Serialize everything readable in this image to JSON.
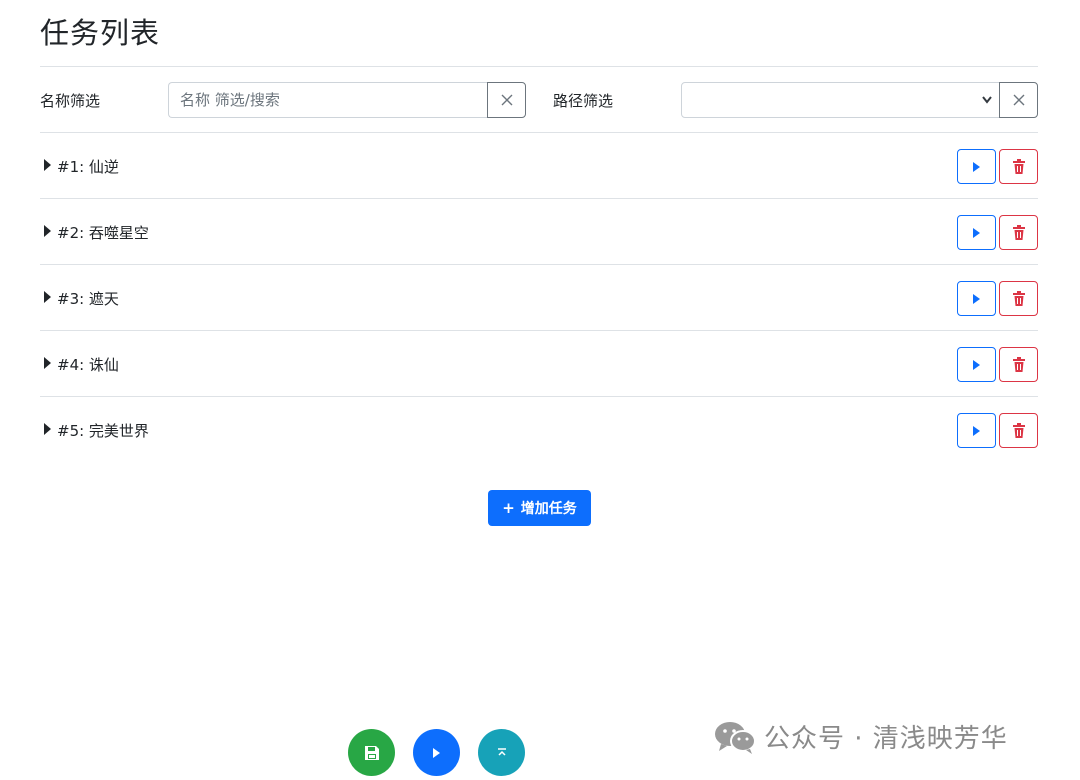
{
  "page": {
    "title": "任务列表"
  },
  "filters": {
    "name_label": "名称筛选",
    "name_placeholder": "名称 筛选/搜索",
    "name_value": "",
    "path_label": "路径筛选",
    "path_selected": ""
  },
  "tasks": [
    {
      "label": "#1: 仙逆"
    },
    {
      "label": "#2: 吞噬星空"
    },
    {
      "label": "#3: 遮天"
    },
    {
      "label": "#4: 诛仙"
    },
    {
      "label": "#5: 完美世界"
    }
  ],
  "actions": {
    "add_plus": "+",
    "add_label": "增加任务"
  },
  "watermark": {
    "text": "公众号 · 清浅映芳华"
  },
  "colors": {
    "primary": "#0d6efd",
    "danger": "#dc3545",
    "success": "#28a745",
    "info": "#17a2b8",
    "secondary": "#6c757d"
  },
  "icons": {
    "row_toggle": "caret-right-icon",
    "run": "play-icon",
    "delete": "trash-icon",
    "clear": "close-icon",
    "save": "save-icon",
    "scroll_top": "arrow-up-to-top-icon",
    "watermark": "wechat-icon"
  }
}
